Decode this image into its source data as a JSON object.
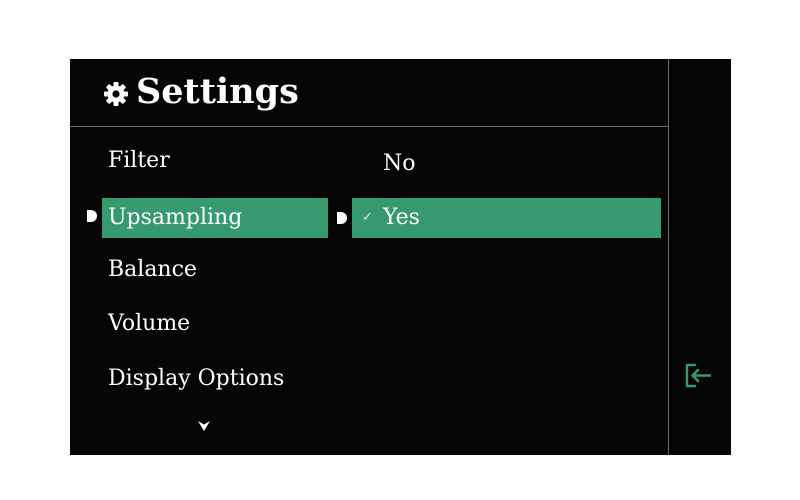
{
  "header": {
    "title": "Settings",
    "icon": "gear-icon"
  },
  "menu": {
    "items": [
      {
        "label": "Filter"
      },
      {
        "label": "Upsampling",
        "selected": true
      },
      {
        "label": "Balance"
      },
      {
        "label": "Volume"
      },
      {
        "label": "Display Options"
      }
    ],
    "more_indicator": "chevron-down-icon"
  },
  "submenu": {
    "options": [
      {
        "label": "No"
      },
      {
        "label": "Yes",
        "selected": true,
        "checked": true
      }
    ],
    "check_mark": "✓"
  },
  "side": {
    "icon": "exit-icon"
  },
  "colors": {
    "background": "#050505",
    "selection": "#369a6e",
    "text": "#ffffff",
    "divider": "#6a6a6a",
    "exit_icon": "#369a6e"
  }
}
